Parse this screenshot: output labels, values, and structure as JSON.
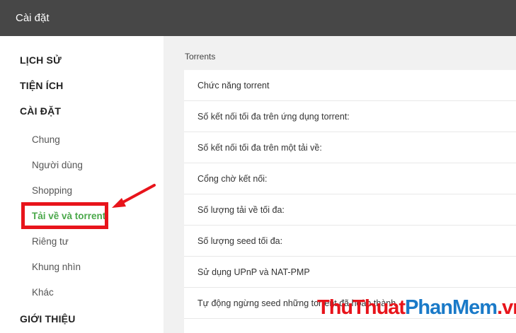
{
  "window": {
    "title": "Cài đặt"
  },
  "sidebar": {
    "sections": [
      {
        "label": "LỊCH SỬ"
      },
      {
        "label": "TIỆN ÍCH"
      },
      {
        "label": "CÀI ĐẶT"
      },
      {
        "label": "GIỚI THIỆU"
      }
    ],
    "settings_items": [
      {
        "label": "Chung"
      },
      {
        "label": "Người dùng"
      },
      {
        "label": "Shopping"
      },
      {
        "label": "Tải về và torrent"
      },
      {
        "label": "Riêng tư"
      },
      {
        "label": "Khung nhìn"
      },
      {
        "label": "Khác"
      }
    ],
    "active_item": "Tải về và torrent"
  },
  "main": {
    "section_title": "Torrents",
    "rows": [
      {
        "label": "Chức năng torrent"
      },
      {
        "label": "Số kết nối tối đa trên ứng dụng torrent:"
      },
      {
        "label": "Số kết nối tối đa trên một tải về:"
      },
      {
        "label": "Cổng chờ kết nối:"
      },
      {
        "label": "Số lượng tải về tối đa:"
      },
      {
        "label": "Số lượng seed tối đa:"
      },
      {
        "label": "Sử dụng UPnP và NAT-PMP"
      },
      {
        "label": "Tự động ngừng seed những torrent đã hoàn thành"
      }
    ]
  },
  "annotation": {
    "highlight_color": "#e8141b",
    "arrow_icon": "arrow-pointer-icon"
  },
  "watermark": {
    "part1": "ThuThuat",
    "part2": "PhanMem",
    "part3": ".vn"
  },
  "colors": {
    "titlebar": "#474747",
    "active": "#4aa84a",
    "content_bg": "#f1f1f1"
  }
}
